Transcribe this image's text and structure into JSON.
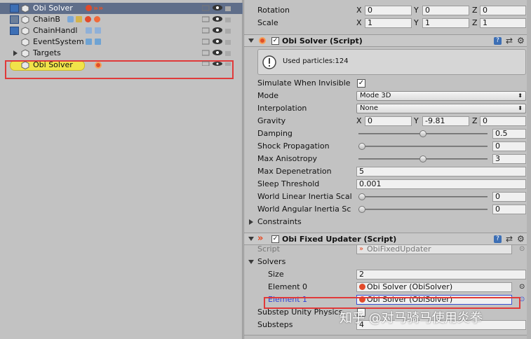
{
  "hierarchy": {
    "items": [
      {
        "name": "Obi Solver",
        "selected": false
      },
      {
        "name": "ChainB"
      },
      {
        "name": "ChainHandl"
      },
      {
        "name": "EventSystem"
      },
      {
        "name": "Targets"
      },
      {
        "name": "Obi Solver",
        "selected": true
      }
    ]
  },
  "transform": {
    "rotation_label": "Rotation",
    "scale_label": "Scale",
    "rotation": {
      "x": "0",
      "y": "0",
      "z": "0"
    },
    "scale": {
      "x": "1",
      "y": "1",
      "z": "1"
    },
    "x": "X",
    "y": "Y",
    "z": "Z"
  },
  "solver": {
    "title": "Obi Solver (Script)",
    "help": "Used particles:124",
    "simulate_label": "Simulate When Invisible",
    "mode_label": "Mode",
    "mode_value": "Mode 3D",
    "interp_label": "Interpolation",
    "interp_value": "None",
    "gravity_label": "Gravity",
    "gravity": {
      "x": "0",
      "y": "-9.81",
      "z": "0"
    },
    "damping_label": "Damping",
    "damping_value": "0.5",
    "damping_level": 0.5,
    "shock_label": "Shock Propagation",
    "shock_value": "0",
    "shock_level": 0,
    "aniso_label": "Max Anisotropy",
    "aniso_value": "3",
    "aniso_level": 0.5,
    "depen_label": "Max Depenetration",
    "depen_value": "5",
    "sleep_label": "Sleep Threshold",
    "sleep_value": "0.001",
    "wlin_label": "World Linear Inertia Scal",
    "wlin_value": "0",
    "wlin_level": 0,
    "wang_label": "World Angular Inertia Sc",
    "wang_value": "0",
    "wang_level": 0,
    "constraints_label": "Constraints"
  },
  "updater": {
    "title": "Obi Fixed Updater (Script)",
    "script_label": "Script",
    "script_value": "ObiFixedUpdater",
    "solvers_label": "Solvers",
    "size_label": "Size",
    "size_value": "2",
    "el0_label": "Element 0",
    "el0_value": "Obi Solver (ObiSolver)",
    "el1_label": "Element 1",
    "el1_value": "Obi Solver (ObiSolver)",
    "substep_label": "Substep Unity Physics",
    "substeps_label": "Substeps",
    "substeps_value": "4"
  },
  "watermark": "知乎 @对马骑马使用炎拳",
  "colors": {
    "selection": "#f1e34a",
    "highlight": "#e03a3a",
    "accent": "#3d6fb5"
  }
}
